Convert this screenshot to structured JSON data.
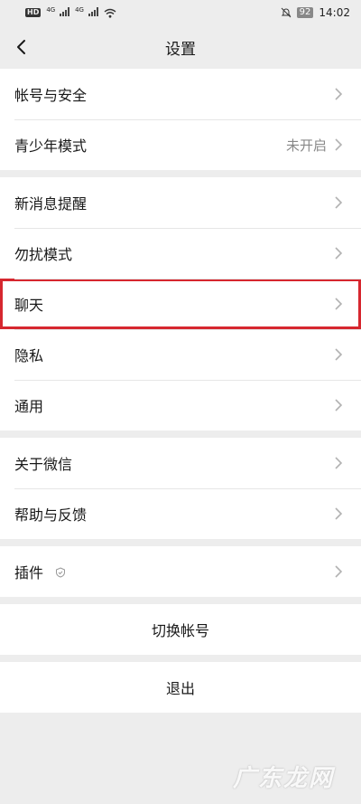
{
  "status_bar": {
    "hd_label": "HD",
    "net_label_1": "4G",
    "net_label_2": "4G",
    "battery": "92",
    "time": "14:02"
  },
  "nav": {
    "title": "设置"
  },
  "groups": [
    {
      "items": [
        {
          "label": "帐号与安全",
          "value": ""
        },
        {
          "label": "青少年模式",
          "value": "未开启"
        }
      ]
    },
    {
      "items": [
        {
          "label": "新消息提醒",
          "value": ""
        },
        {
          "label": "勿扰模式",
          "value": ""
        },
        {
          "label": "聊天",
          "value": ""
        },
        {
          "label": "隐私",
          "value": ""
        },
        {
          "label": "通用",
          "value": ""
        }
      ]
    },
    {
      "items": [
        {
          "label": "关于微信",
          "value": ""
        },
        {
          "label": "帮助与反馈",
          "value": ""
        }
      ]
    },
    {
      "items": [
        {
          "label": "插件",
          "value": ""
        }
      ]
    }
  ],
  "actions": {
    "switch_account": "切换帐号",
    "logout": "退出"
  },
  "watermark": "广东龙网",
  "colors": {
    "background": "#ededed",
    "highlight": "#d6272f",
    "secondary_text": "#888888"
  }
}
